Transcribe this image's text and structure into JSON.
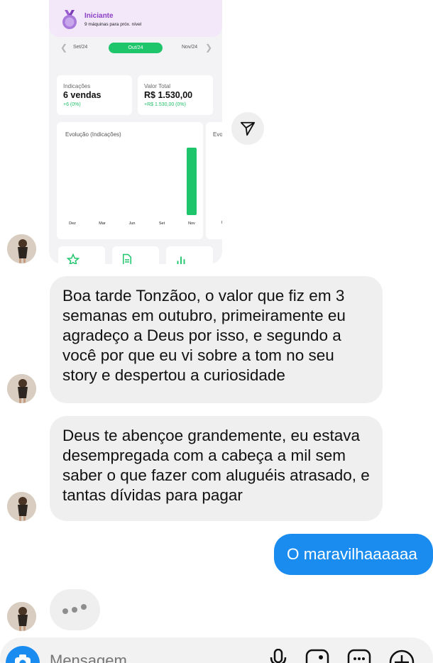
{
  "shared_screenshot": {
    "level": {
      "title": "Iniciante",
      "subtitle": "9 máquinas para próx. nível"
    },
    "months": {
      "prev": "Set/24",
      "current": "Out/24",
      "next": "Nov/24"
    },
    "stats": [
      {
        "label": "Indicações",
        "value": "6 vendas",
        "change": "+6 (0%)"
      },
      {
        "label": "Valor Total",
        "value": "R$ 1.530,00",
        "change": "+R$ 1.530,00 (0%)"
      }
    ],
    "chart_title": "Evolução (Indicações)",
    "chart2_title": "Evo",
    "chart2_tick": "D",
    "chart_data": {
      "type": "bar",
      "categories": [
        "Dez",
        "Mar",
        "Jun",
        "Set",
        "Nov"
      ],
      "values": [
        0,
        0,
        0,
        0,
        6
      ],
      "title": "Evolução (Indicações)",
      "xlabel": "",
      "ylabel": "",
      "ylim": [
        0,
        6
      ],
      "bar_color": "#1fc56b",
      "grid": false
    }
  },
  "conversation": {
    "messages": [
      {
        "direction": "incoming",
        "text": "Boa tarde Tonzãoo, o valor que fiz em 3 semanas em outubro, primeiramente eu agradeço a Deus por isso, e segundo a você por que eu vi sobre a tom no seu story e despertou a curiosidade"
      },
      {
        "direction": "incoming",
        "text": "Deus te abençoe grandemente, eu estava desempregada com a cabeça a mil sem saber o que fazer com aluguéis atrasado, e tantas dívidas para pagar"
      },
      {
        "direction": "outgoing",
        "text": "O maravilhaaaaaa"
      }
    ],
    "typing_indicator": true
  },
  "composer": {
    "placeholder": "Mensagem",
    "icons": [
      "camera-icon",
      "microphone-icon",
      "gallery-icon",
      "sticker-icon",
      "add-icon"
    ]
  },
  "colors": {
    "accent_blue": "#1a8cf0",
    "incoming_bubble": "#efefef",
    "chart_green": "#1fc56b",
    "level_purple": "#8b3fc4"
  }
}
